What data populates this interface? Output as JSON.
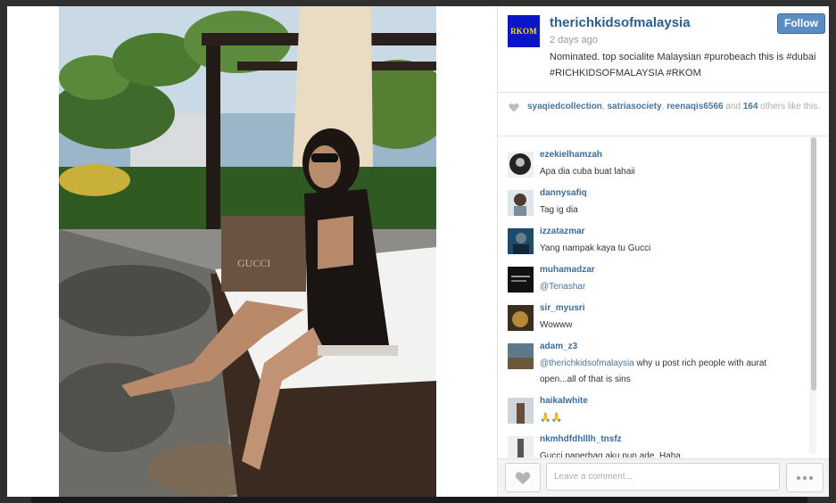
{
  "post": {
    "username": "therichkidsofmalaysia",
    "avatar_text": "RKOM",
    "follow_label": "Follow",
    "time": "2 days ago",
    "caption": "Nominated. top socialite Malaysian #purobeach this is #dubai #RICHKIDSOFMALAYSIA #RKOM",
    "photo_bag_text": "GUCCI"
  },
  "likes": {
    "users": [
      "syaqiedcollection",
      "satriasociety",
      "reenaqis6566"
    ],
    "sep1": ", ",
    "sep2": ", ",
    "and_text": " and ",
    "count": "164",
    "suffix": " others like this."
  },
  "comments": [
    {
      "user": "ezekielhamzah",
      "text": "Apa dia cuba buat lahaii"
    },
    {
      "user": "dannysafiq",
      "text": "Tag ig dia"
    },
    {
      "user": "izzatazmar",
      "text": "Yang nampak kaya tu Gucci"
    },
    {
      "user": "muhamadzar",
      "mention": "@Tenashar",
      "text": ""
    },
    {
      "user": "sir_myusri",
      "text": "Wowww"
    },
    {
      "user": "adam_z3",
      "mention": "@therichkidsofmalaysia",
      "text": " why u post rich people with aurat open...all of that is sins"
    },
    {
      "user": "haikalwhite",
      "text": "🙏🙏"
    },
    {
      "user": "nkmhdfdhlllh_tnsfz",
      "text": "Gucci paperbag aku pun ade. Haha"
    }
  ],
  "footer": {
    "comment_placeholder": "Leave a comment..."
  },
  "icons": {
    "like": "heart-icon",
    "more": "ellipsis-icon"
  },
  "colors": {
    "username": "#2d5e8a",
    "follow_button": "#5a8ec2",
    "avatar_bg": "#0a14c8",
    "avatar_text": "#f3e500"
  }
}
